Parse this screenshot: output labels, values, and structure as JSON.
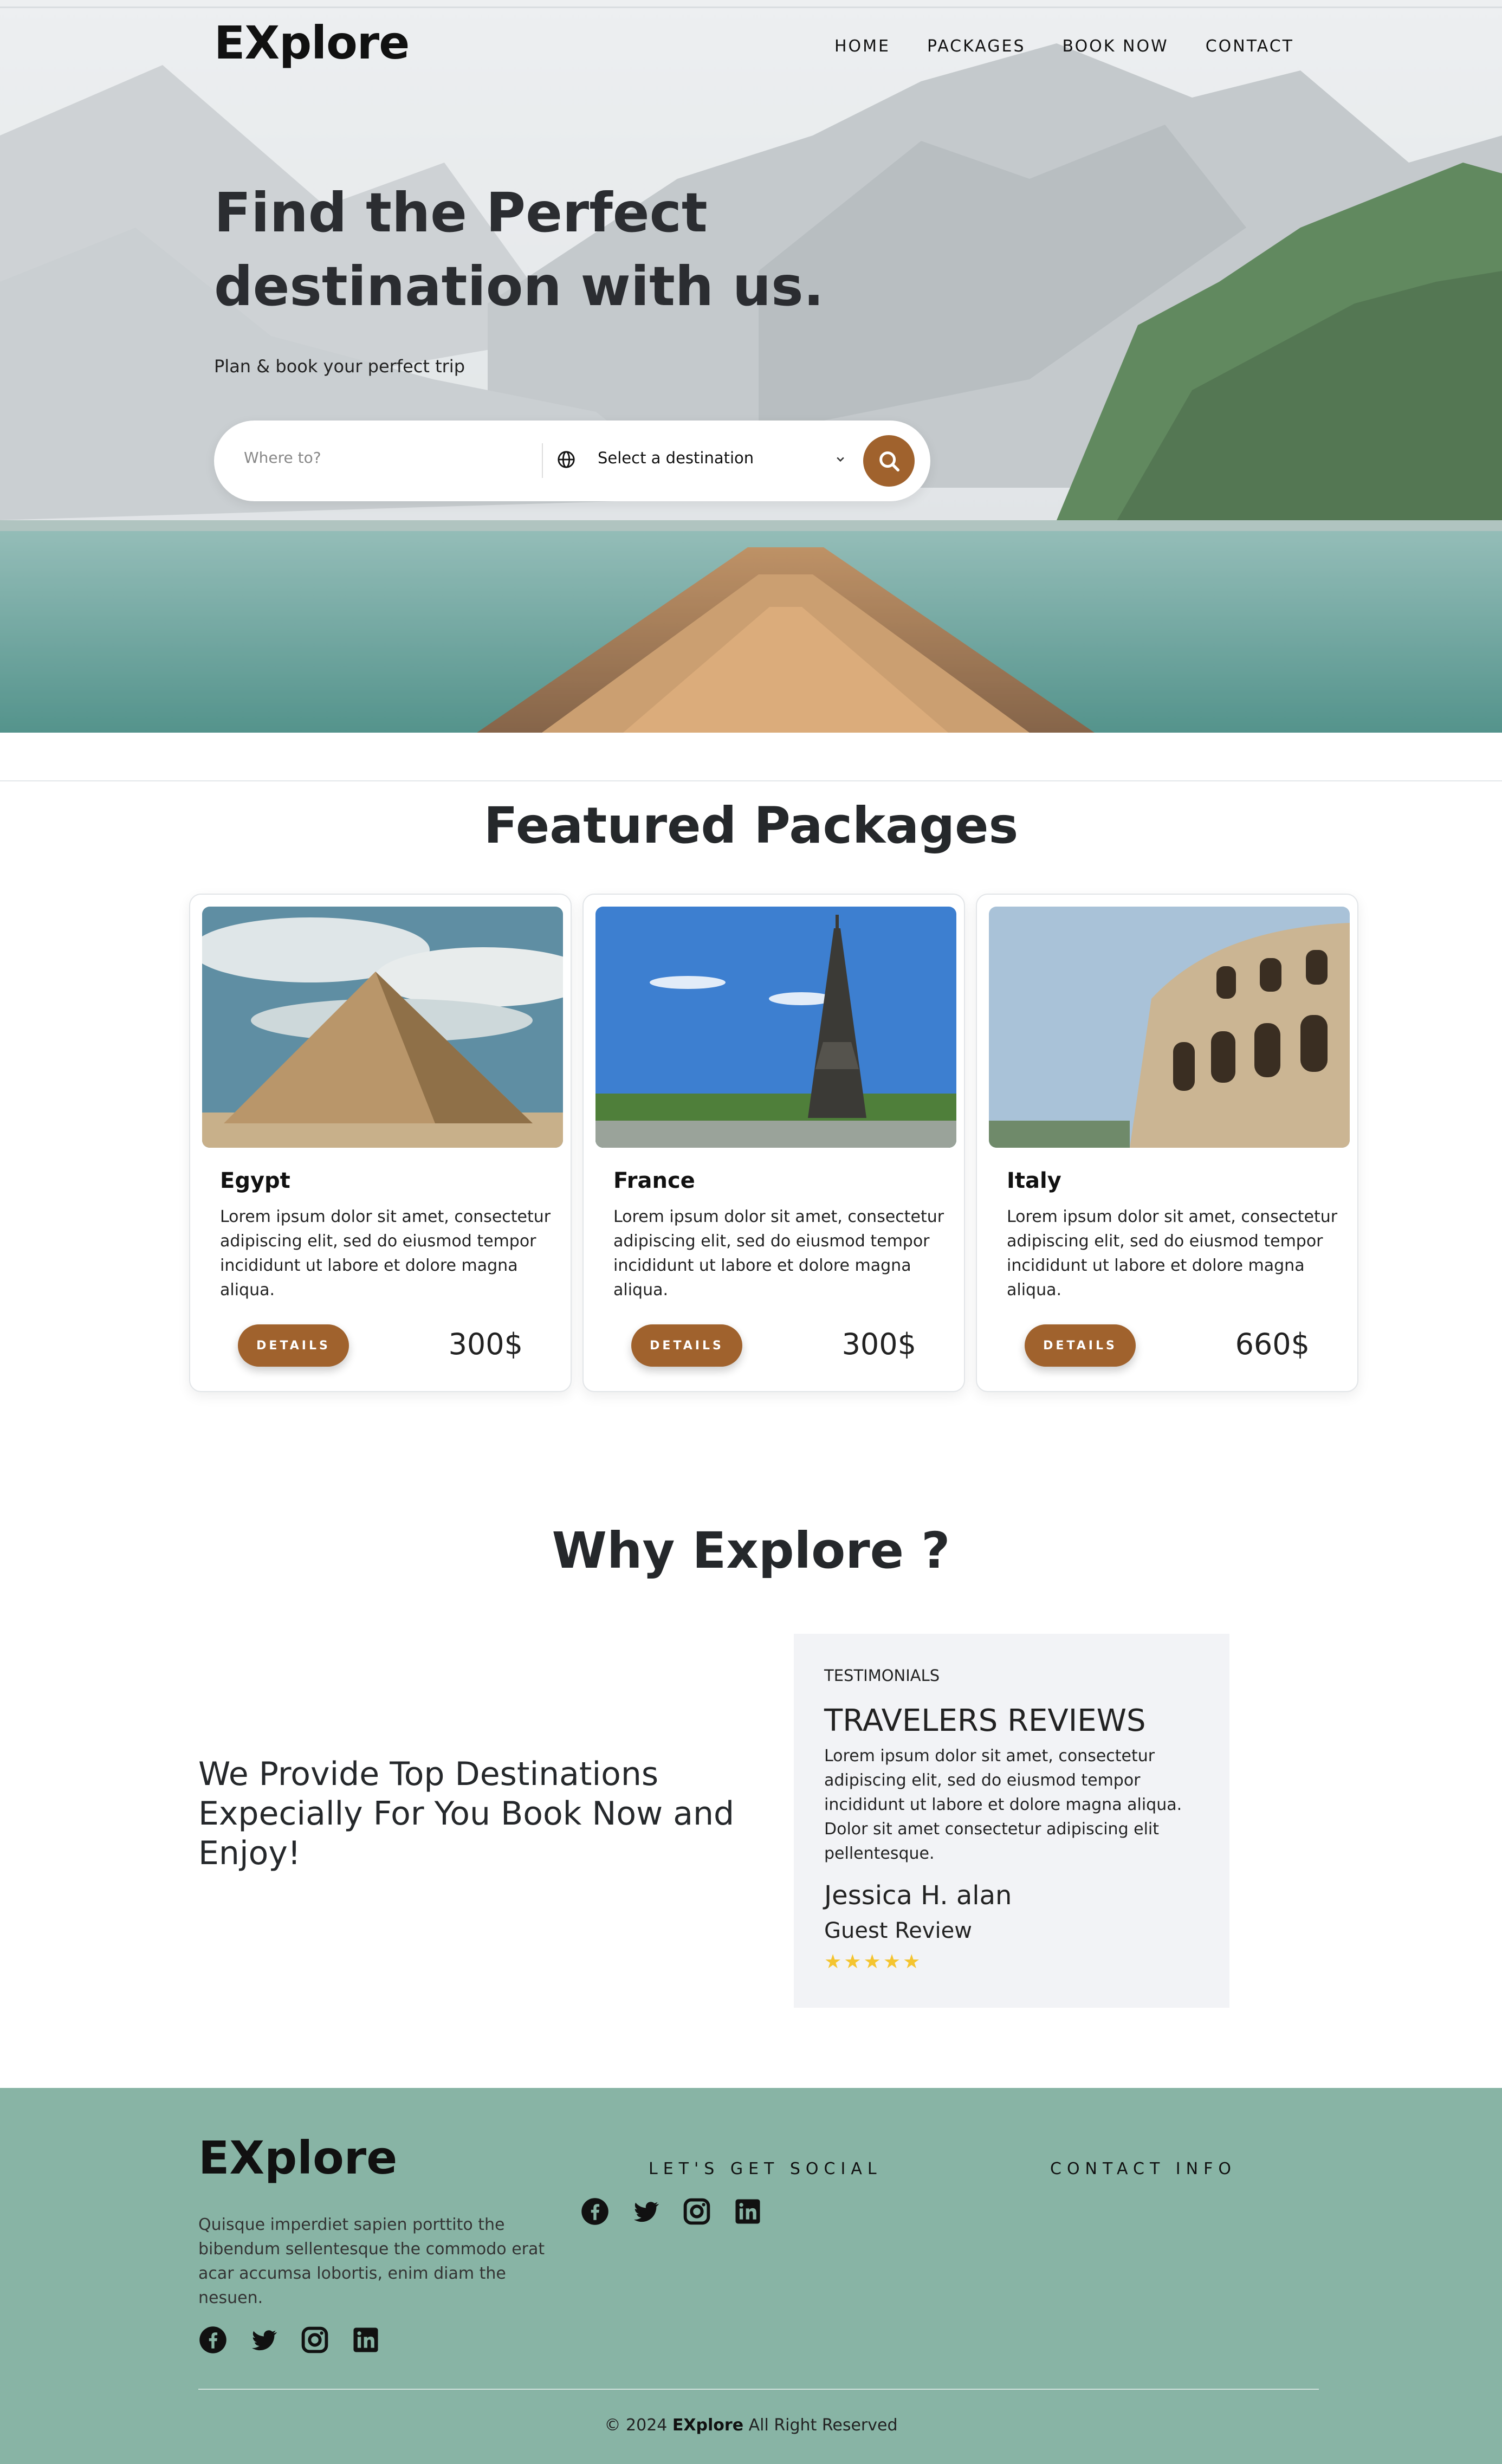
{
  "header": {
    "brand": "EXplore",
    "nav": [
      "HOME",
      "PACKAGES",
      "BOOK NOW",
      "CONTACT"
    ]
  },
  "hero": {
    "title": "Find the Perfect destination with us.",
    "subtitle": "Plan & book your perfect trip",
    "search": {
      "where_placeholder": "Where to?",
      "select_value": "Select a destination"
    }
  },
  "featured": {
    "title": "Featured Packages",
    "details_label": "DETAILS",
    "cards": [
      {
        "name": "Egypt",
        "desc": "Lorem ipsum dolor sit amet, consectetur adipiscing elit, sed do eiusmod tempor incididunt ut labore et dolore magna aliqua.",
        "price": "300$"
      },
      {
        "name": "France",
        "desc": "Lorem ipsum dolor sit amet, consectetur adipiscing elit, sed do eiusmod tempor incididunt ut labore et dolore magna aliqua.",
        "price": "300$"
      },
      {
        "name": "Italy",
        "desc": "Lorem ipsum dolor sit amet, consectetur adipiscing elit, sed do eiusmod tempor incididunt ut labore et dolore magna aliqua.",
        "price": "660$"
      }
    ]
  },
  "why": {
    "title": "Why Explore ?",
    "tagline": "We Provide Top Destinations Expecially For You Book Now and Enjoy!",
    "testimonial": {
      "label": "TESTIMONIALS",
      "heading": "TRAVELERS REVIEWS",
      "text": "Lorem ipsum dolor sit amet, consectetur adipiscing elit, sed do eiusmod tempor incididunt ut labore et dolore magna aliqua. Dolor sit amet consectetur adipiscing elit pellentesque.",
      "author": "Jessica H. alan",
      "role": "Guest Review",
      "stars": "★★★★★",
      "rating": 5
    }
  },
  "footer": {
    "brand": "EXplore",
    "about": "Quisque imperdiet sapien porttito the bibendum sellentesque the commodo erat acar accumsa lobortis, enim diam the nesuen.",
    "social_heading": "LET'S GET SOCIAL",
    "contact_heading": "CONTACT INFO",
    "copy_prefix": "© 2024",
    "copy_brand": "EXplore",
    "copy_suffix": "All Right Reserved",
    "icons": [
      "facebook-icon",
      "twitter-icon",
      "instagram-icon",
      "linkedin-icon"
    ]
  },
  "colors": {
    "accent": "#a0622d",
    "footer_bg": "#88b4a5",
    "testimonial_bg": "#f2f3f6",
    "star": "#f4c430"
  }
}
